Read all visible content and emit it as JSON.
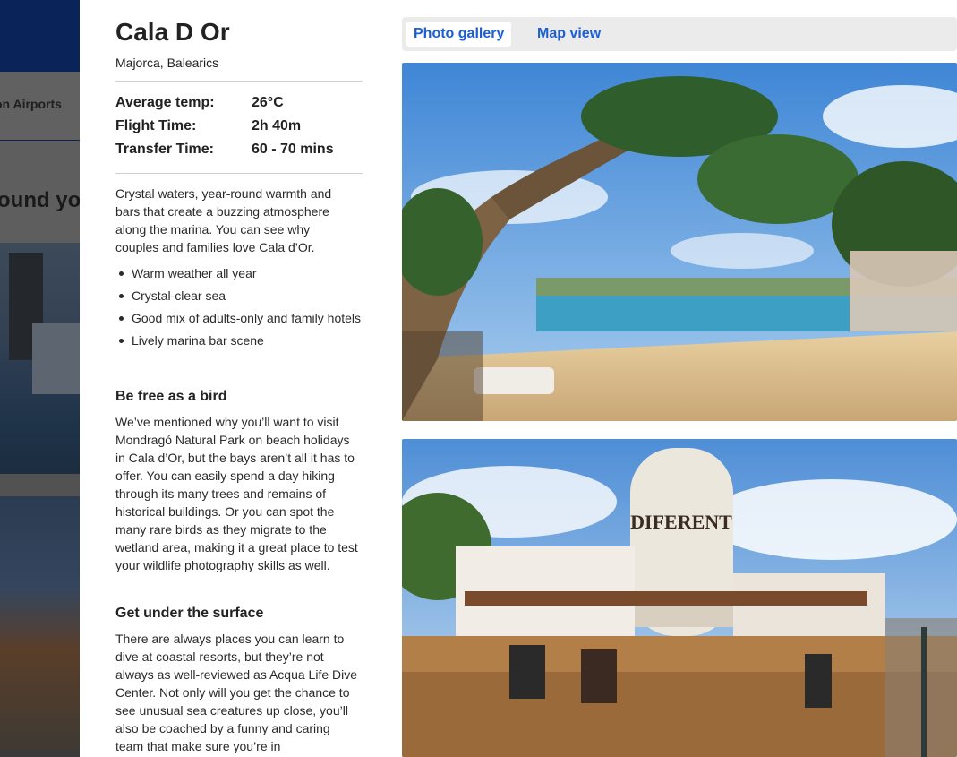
{
  "background": {
    "nav_text": "on Airports",
    "heading_text": "ound yo"
  },
  "destination": {
    "title": "Cala D Or",
    "subtitle": "Majorca, Balearics",
    "facts": [
      {
        "label": "Average temp:",
        "value": "26°C"
      },
      {
        "label": "Flight Time:",
        "value": "2h 40m"
      },
      {
        "label": "Transfer Time:",
        "value": "60 - 70 mins"
      }
    ],
    "intro": "Crystal waters, year-round warmth and bars that create a buzzing atmosphere along the marina. You can see why couples and families love Cala d’Or.",
    "highlights": [
      "Warm weather all year",
      "Crystal-clear sea",
      "Good mix of adults-only and family hotels",
      "Lively marina bar scene"
    ],
    "sections": [
      {
        "heading": "Be free as a bird",
        "body": "We’ve mentioned why you’ll want to visit Mondragó Natural Park on beach holidays in Cala d’Or, but the bays aren’t all it has to offer. You can easily spend a day hiking through its many trees and remains of historical buildings. Or you can spot the many rare birds as they migrate to the wetland area, making it a great place to test your wildlife photography skills as well."
      },
      {
        "heading": "Get under the surface",
        "body": "There are always places you can learn to dive at coastal resorts, but they’re not always as well-reviewed as Acqua Life Dive Center. Not only will you get the chance to see unusual sea creatures up close, you’ll also be coached by a funny and caring team that make sure you’re in"
      }
    ]
  },
  "view_tabs": {
    "gallery_label": "Photo gallery",
    "map_label": "Map view",
    "active": "gallery"
  },
  "gallery": {
    "photo2_sign": "DIFERENT"
  }
}
